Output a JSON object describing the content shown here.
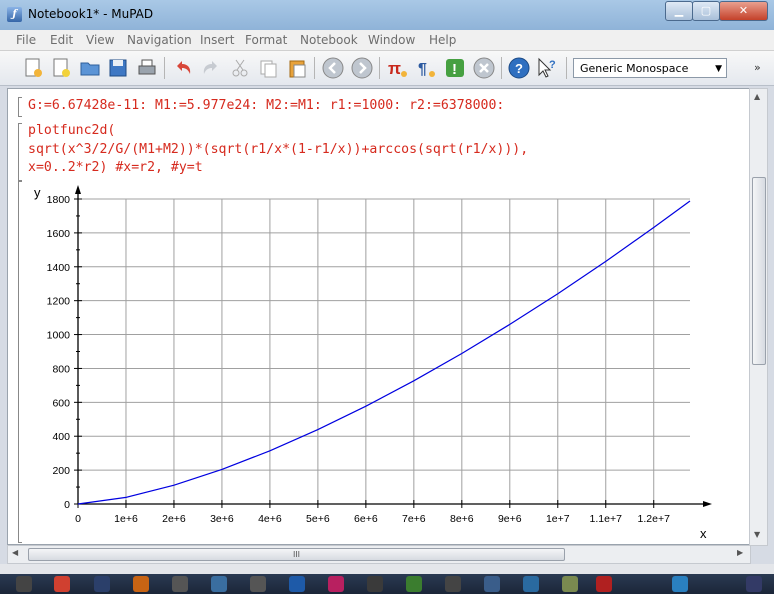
{
  "window": {
    "title": "Notebook1* - MuPAD",
    "app_icon": "mupad-icon"
  },
  "menubar": {
    "items": [
      "File",
      "Edit",
      "View",
      "Navigation",
      "Insert",
      "Format",
      "Notebook",
      "Window",
      "Help"
    ]
  },
  "toolbar": {
    "font_select_value": "Generic Monospace",
    "overflow_label": "»"
  },
  "notebook": {
    "input1": "G:=6.67428e-11: M1:=5.977e24: M2:=M1: r1:=1000: r2:=6378000:",
    "input2_lines": [
      "plotfunc2d(",
      "sqrt(x^3/2/G/(M1+M2))*(sqrt(r1/x*(1-r1/x))+arccos(sqrt(r1/x))),",
      "x=0..2*r2) #x=r2, #y=t"
    ]
  },
  "scrollbar": {
    "grip_label": "III"
  },
  "colors": {
    "input_text": "#d62a1e",
    "curve": "#0000e0",
    "grid": "#a0a0a0"
  },
  "chart_data": {
    "type": "line",
    "xlabel": "x",
    "ylabel": "y",
    "xlim": [
      0,
      12756000
    ],
    "ylim": [
      0,
      1800
    ],
    "x_ticks": [
      "0",
      "1e+6",
      "2e+6",
      "3e+6",
      "4e+6",
      "5e+6",
      "6e+6",
      "7e+6",
      "8e+6",
      "9e+6",
      "1e+7",
      "1.1e+7",
      "1.2e+7"
    ],
    "y_ticks": [
      "0",
      "200",
      "400",
      "600",
      "800",
      "1000",
      "1200",
      "1400",
      "1600",
      "1800"
    ],
    "grid": true,
    "series": [
      {
        "x": [
          0,
          1000000,
          2000000,
          3000000,
          4000000,
          5000000,
          6000000,
          7000000,
          8000000,
          9000000,
          10000000,
          11000000,
          12000000,
          12756000
        ],
        "values": [
          0,
          39,
          111,
          204,
          314,
          439,
          577,
          727,
          888,
          1060,
          1241,
          1432,
          1632,
          1788
        ]
      }
    ]
  }
}
